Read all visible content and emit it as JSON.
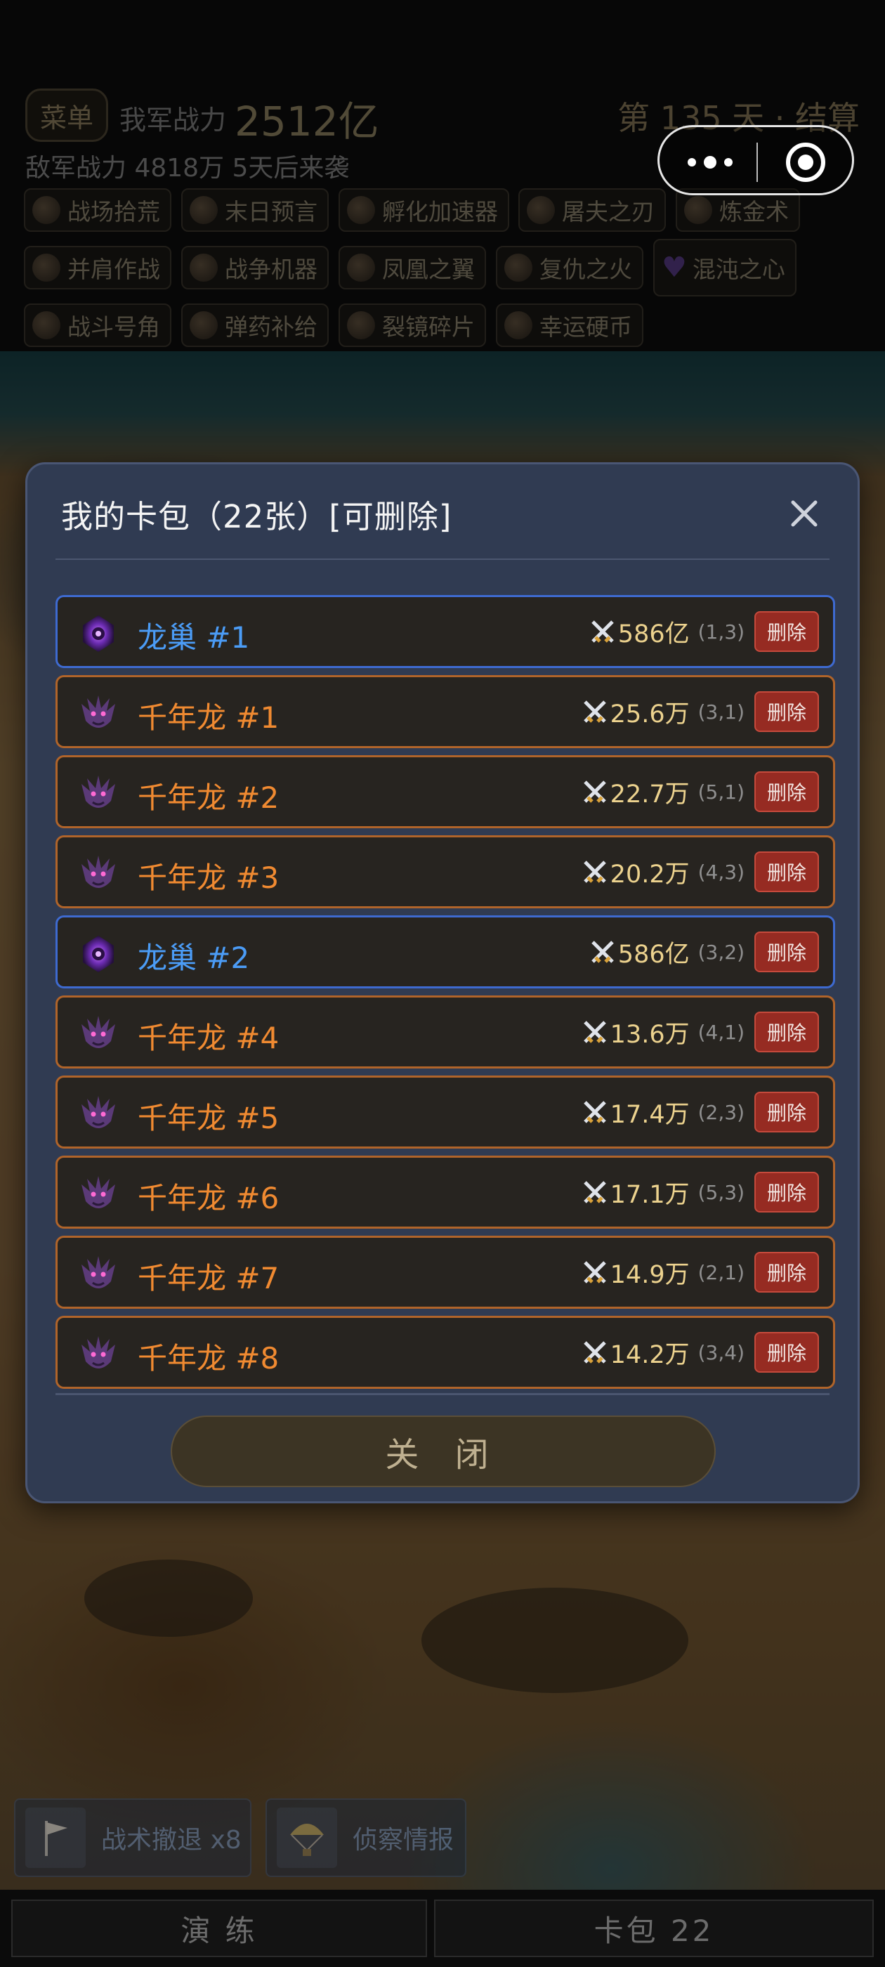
{
  "hud": {
    "menu_label": "菜单",
    "power_label": "我军战力",
    "power_value": "2512亿",
    "day_text": "第 135 天 · 结算",
    "enemy_text": "敌军战力 4818万  5天后来袭",
    "chips": [
      {
        "label": "战场拾荒",
        "icon": "scavenge-icon"
      },
      {
        "label": "末日预言",
        "icon": "doom-icon"
      },
      {
        "label": "孵化加速器",
        "icon": "incubator-icon"
      },
      {
        "label": "屠夫之刃",
        "icon": "blade-icon"
      },
      {
        "label": "炼金术",
        "icon": "alchemy-icon"
      },
      {
        "label": "并肩作战",
        "icon": "ally-icon"
      },
      {
        "label": "战争机器",
        "icon": "war-machine-icon"
      },
      {
        "label": "凤凰之翼",
        "icon": "phoenix-icon"
      },
      {
        "label": "复仇之火",
        "icon": "fire-icon"
      },
      {
        "label": "混沌之心",
        "icon": "purple-heart-icon"
      },
      {
        "label": "战斗号角",
        "icon": "horn-icon"
      },
      {
        "label": "弹药补给",
        "icon": "ammo-icon"
      },
      {
        "label": "裂镜碎片",
        "icon": "shard-icon"
      },
      {
        "label": "幸运硬币",
        "icon": "coin-icon"
      }
    ]
  },
  "dialog": {
    "title": "我的卡包（22张）[可删除]",
    "close_label": "关 闭",
    "delete_label": "删除",
    "cards": [
      {
        "name": "龙巢 #1",
        "power": "586亿",
        "pos": "(1,3)",
        "type": "nest"
      },
      {
        "name": "千年龙 #1",
        "power": "25.6万",
        "pos": "(3,1)",
        "type": "dragon"
      },
      {
        "name": "千年龙 #2",
        "power": "22.7万",
        "pos": "(5,1)",
        "type": "dragon"
      },
      {
        "name": "千年龙 #3",
        "power": "20.2万",
        "pos": "(4,3)",
        "type": "dragon"
      },
      {
        "name": "龙巢 #2",
        "power": "586亿",
        "pos": "(3,2)",
        "type": "nest"
      },
      {
        "name": "千年龙 #4",
        "power": "13.6万",
        "pos": "(4,1)",
        "type": "dragon"
      },
      {
        "name": "千年龙 #5",
        "power": "17.4万",
        "pos": "(2,3)",
        "type": "dragon"
      },
      {
        "name": "千年龙 #6",
        "power": "17.1万",
        "pos": "(5,3)",
        "type": "dragon"
      },
      {
        "name": "千年龙 #7",
        "power": "14.9万",
        "pos": "(2,1)",
        "type": "dragon"
      },
      {
        "name": "千年龙 #8",
        "power": "14.2万",
        "pos": "(3,4)",
        "type": "dragon"
      }
    ]
  },
  "bottom": {
    "retreat_label": "战术撤退 x8",
    "recon_label": "侦察情报",
    "drill_label": "演 练",
    "cardpack_label": "卡包 22"
  },
  "colors": {
    "rare_blue": "#4b9cf6",
    "epic_orange": "#f08a31",
    "delete_red": "#962b22",
    "power_gold": "#ecd28e",
    "dialog_bg": "#303b52"
  }
}
